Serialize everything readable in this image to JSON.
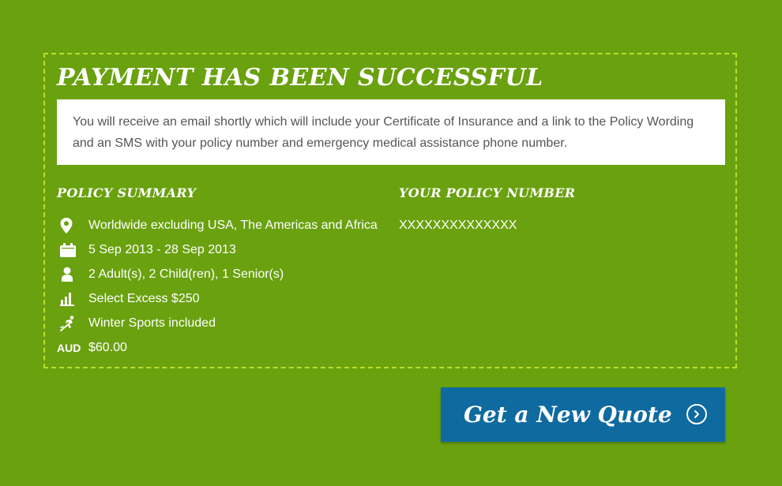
{
  "header": {
    "title": "PAYMENT HAS BEEN SUCCESSFUL"
  },
  "notice": {
    "text": "You will receive an email shortly which will include your Certificate of Insurance and a link to the Policy Wording and an SMS with your policy number and emergency medical assistance phone number."
  },
  "summary": {
    "heading": "POLICY SUMMARY",
    "items": [
      {
        "icon": "location-pin-icon",
        "text": "Worldwide excluding USA, The Americas and Africa"
      },
      {
        "icon": "calendar-icon",
        "text": "5 Sep 2013 - 28 Sep 2013"
      },
      {
        "icon": "person-icon",
        "text": "2 Adult(s), 2 Child(ren), 1 Senior(s)"
      },
      {
        "icon": "bar-chart-icon",
        "text": "Select Excess $250"
      },
      {
        "icon": "skier-icon",
        "text": "Winter Sports included"
      },
      {
        "icon": "currency-code",
        "label": "AUD",
        "text": "$60.00"
      }
    ]
  },
  "policy": {
    "heading": "YOUR POLICY NUMBER",
    "number": "XXXXXXXXXXXXXX"
  },
  "actions": {
    "new_quote_label": "Get a New Quote",
    "new_quote_icon": "chevron-right-circle-icon"
  },
  "colors": {
    "background": "#6aa10f",
    "dashed_border": "#b6e02a",
    "button": "#0f6aa0",
    "text_light": "#ffffff",
    "text_dark": "#555555"
  }
}
